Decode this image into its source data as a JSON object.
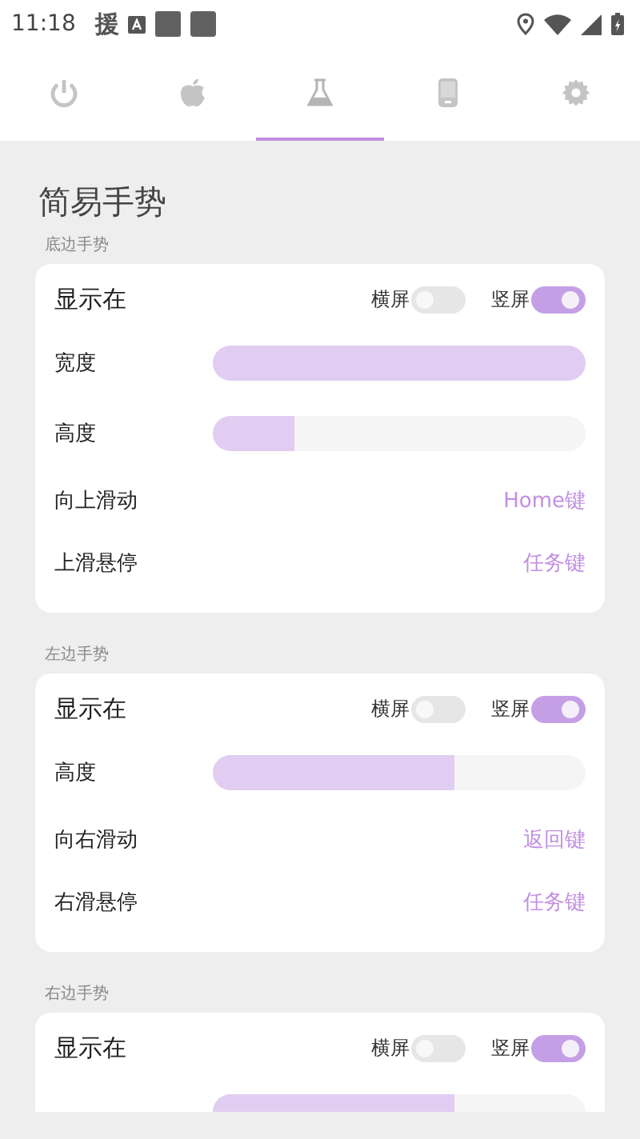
{
  "status_bar": {
    "time": "11:18",
    "notification": "援"
  },
  "tabs": [
    {
      "kind": "power",
      "selected": false
    },
    {
      "kind": "apple",
      "selected": false
    },
    {
      "kind": "flask",
      "selected": true
    },
    {
      "kind": "phone",
      "selected": false
    },
    {
      "kind": "gear",
      "selected": false
    }
  ],
  "title": "简易手势",
  "sections": [
    {
      "label": "底边手势",
      "rows": [
        {
          "kind": "toggles",
          "label": "显示在",
          "toggles": [
            {
              "label": "横屏",
              "on": false
            },
            {
              "label": "竖屏",
              "on": true
            }
          ]
        },
        {
          "kind": "slider",
          "label": "宽度",
          "level": 1.0
        },
        {
          "kind": "slider",
          "label": "高度",
          "level": 0.22
        },
        {
          "kind": "choice",
          "label": "向上滑动",
          "value": "Home键"
        },
        {
          "kind": "choice",
          "label": "上滑悬停",
          "value": "任务键"
        }
      ]
    },
    {
      "label": "左边手势",
      "rows": [
        {
          "kind": "toggles",
          "label": "显示在",
          "toggles": [
            {
              "label": "横屏",
              "on": false
            },
            {
              "label": "竖屏",
              "on": true
            }
          ]
        },
        {
          "kind": "slider",
          "label": "高度",
          "level": 0.65
        },
        {
          "kind": "choice",
          "label": "向右滑动",
          "value": "返回键"
        },
        {
          "kind": "choice",
          "label": "右滑悬停",
          "value": "任务键"
        }
      ]
    },
    {
      "label": "右边手势",
      "rows": [
        {
          "kind": "toggles",
          "label": "显示在",
          "toggles": [
            {
              "label": "横屏",
              "on": false
            },
            {
              "label": "竖屏",
              "on": true
            }
          ]
        },
        {
          "kind": "slider",
          "level": 0.65
        }
      ]
    }
  ]
}
